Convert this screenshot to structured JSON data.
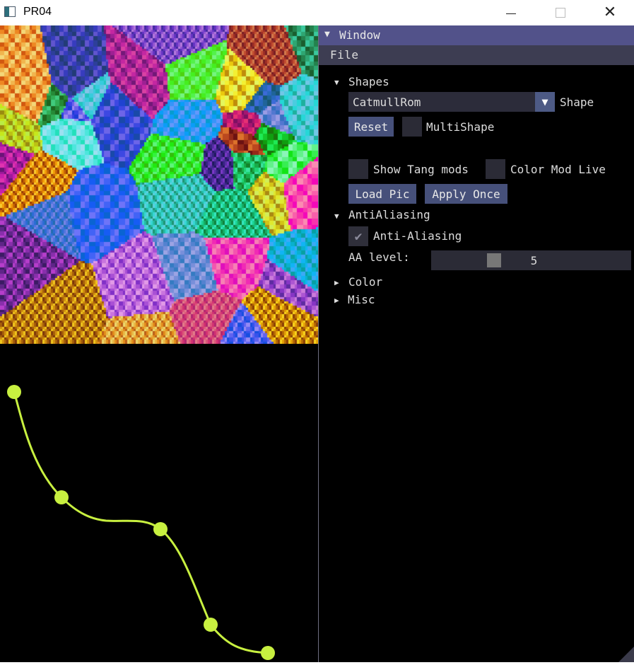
{
  "window": {
    "title": "PR04",
    "minimize_icon": "minimize-icon",
    "maximize_icon": "maximize-icon",
    "close_icon": "close-icon"
  },
  "panel": {
    "title": "Window",
    "menu": [
      "File"
    ],
    "shapes": {
      "header": "Shapes",
      "shape_value": "CatmullRom",
      "shape_label": "Shape",
      "reset_label": "Reset",
      "multishape_label": "MultiShape",
      "multishape_checked": false,
      "show_tang_label": "Show Tang mods",
      "show_tang_checked": false,
      "color_mod_label": "Color Mod Live",
      "color_mod_checked": false,
      "load_pic_label": "Load Pic",
      "apply_once_label": "Apply Once"
    },
    "antialiasing": {
      "header": "AntiAliasing",
      "checkbox_label": "Anti-Aliasing",
      "checked": true,
      "level_label": "AA level:",
      "level_value": "5"
    },
    "collapsed": [
      "Color",
      "Misc"
    ]
  },
  "curve": {
    "color": "#c8f040",
    "control_points": 5
  },
  "colors": {
    "panel_title_bg": "#52528a",
    "menubar_bg": "#3d3d52",
    "button_bg": "#46507a",
    "frame_bg": "#2b2b36"
  }
}
